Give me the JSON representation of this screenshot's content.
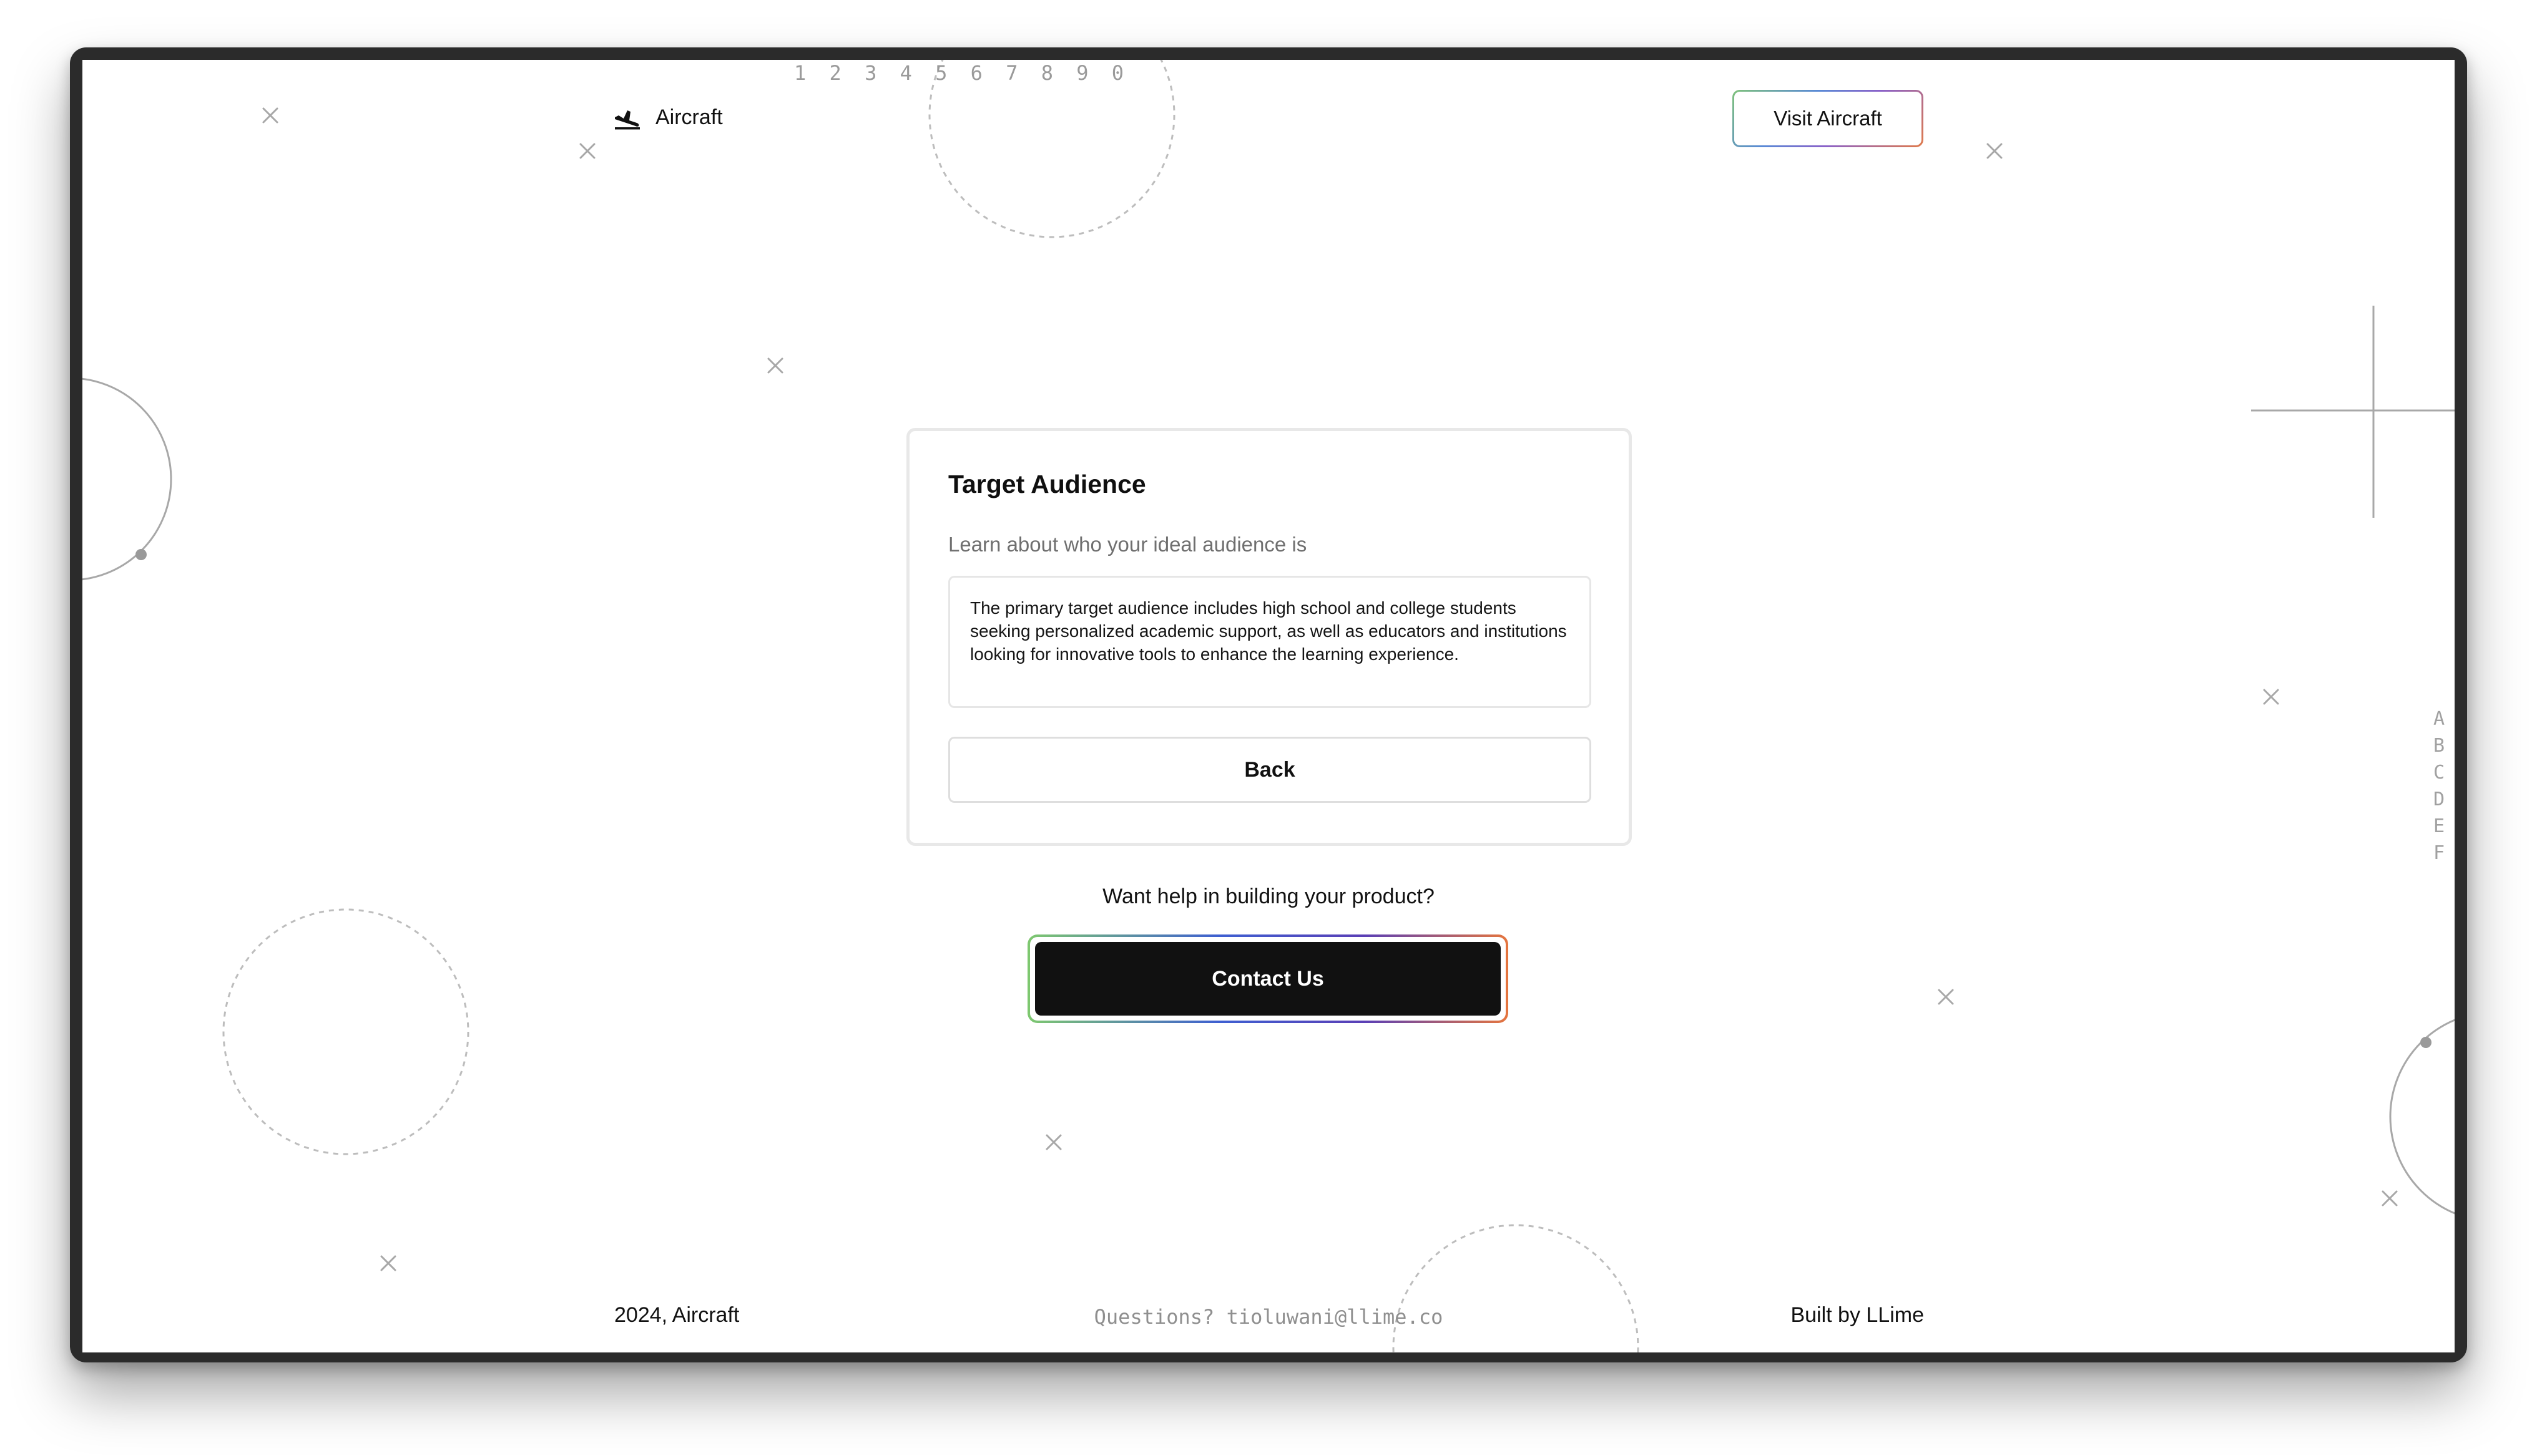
{
  "decor": {
    "numbers": "1 2 3 4 5 6 7 8 9 0",
    "letters": [
      "A",
      "B",
      "C",
      "D",
      "E",
      "F"
    ]
  },
  "header": {
    "brand_icon": "airplane-landing-icon",
    "brand_label": "Aircraft",
    "visit_label": "Visit Aircraft"
  },
  "card": {
    "title": "Target Audience",
    "subtitle": "Learn about who your ideal audience is",
    "answer": "The primary target audience includes high school and college students seeking personalized academic support, as well as educators and institutions looking for innovative tools to enhance the learning experience.",
    "back_label": "Back"
  },
  "cta": {
    "question": "Want help in building your product?",
    "contact_label": "Contact Us"
  },
  "footer": {
    "left": "2024, Aircraft",
    "center": "Questions? tioluwani@llime.co",
    "right": "Built by LLime"
  },
  "colors": {
    "primary_button": "#111111",
    "gradient_green": "#7ec86f",
    "gradient_blue": "#3e5fd1",
    "gradient_purple": "#5a3fb6",
    "gradient_orange": "#e5753e"
  }
}
